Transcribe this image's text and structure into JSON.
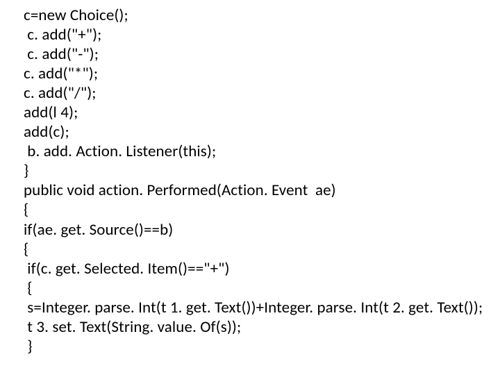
{
  "code": {
    "lines": [
      "c=new Choice();",
      " c. add(\"+\");",
      " c. add(\"-\");",
      "c. add(\"*\");",
      "c. add(\"/\");",
      "add(l 4);",
      "add(c);",
      " b. add. Action. Listener(this);",
      "}",
      "public void action. Performed(Action. Event  ae)",
      "{",
      "if(ae. get. Source()==b)",
      "{",
      " if(c. get. Selected. Item()==\"+\")",
      " {",
      " s=Integer. parse. Int(t 1. get. Text())+Integer. parse. Int(t 2. get. Text());",
      " t 3. set. Text(String. value. Of(s));",
      " }"
    ]
  }
}
